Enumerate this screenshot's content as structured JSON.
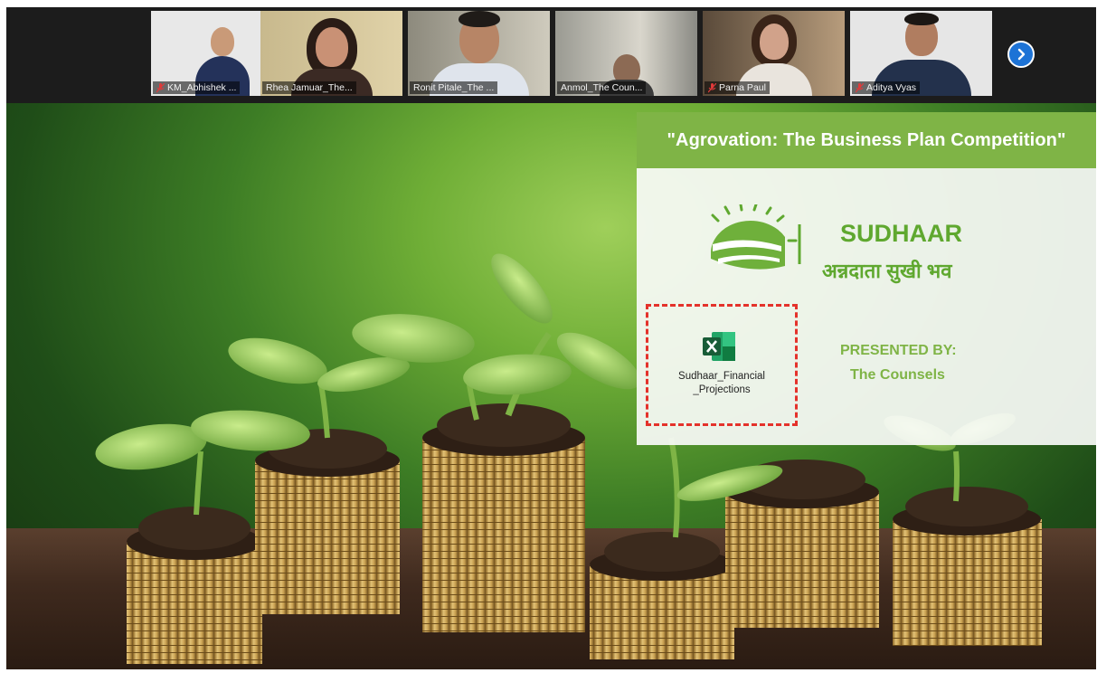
{
  "participants": [
    {
      "name": "KM_Abhishek ...",
      "muted": true
    },
    {
      "name": "Rhea Jamuar_The...",
      "muted": false
    },
    {
      "name": "Ronit Pitale_The ...",
      "muted": false
    },
    {
      "name": "Anmol_The Coun...",
      "muted": false
    },
    {
      "name": "Parna Paul",
      "muted": true
    },
    {
      "name": "Aditya Vyas",
      "muted": true
    }
  ],
  "next_button_icon": "chevron-right-icon",
  "slide": {
    "title": "\"Agrovation: The Business Plan Competition\"",
    "brand": "SUDHAAR",
    "tagline": "अन्नदाता सुखी भव",
    "presented_by": "PRESENTED BY:",
    "team": "The Counsels",
    "file": {
      "name_line1": "Sudhaar_Financial",
      "name_line2": "_Projections",
      "icon": "excel-file-icon"
    }
  },
  "colors": {
    "accent_green": "#7fb446",
    "brand_green": "#5fa82f",
    "highlight_red": "#e4322b",
    "zoom_blue": "#1d73d6"
  }
}
